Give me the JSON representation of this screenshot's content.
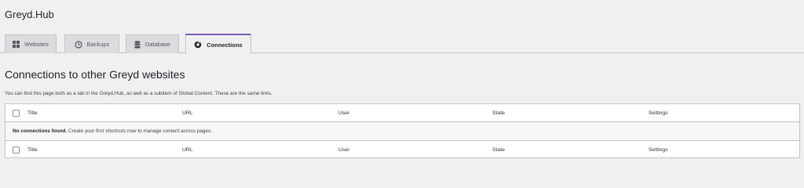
{
  "app": {
    "title": "Greyd.Hub"
  },
  "tabs": [
    {
      "label": "Websites",
      "icon": "grid-icon",
      "active": false
    },
    {
      "label": "Backups",
      "icon": "history-icon",
      "active": false
    },
    {
      "label": "Database",
      "icon": "database-icon",
      "active": false
    },
    {
      "label": "Connections",
      "icon": "connections-icon",
      "active": true
    }
  ],
  "main": {
    "heading": "Connections to other Greyd websites",
    "description": "You can find this page both as a tab in the Greyd.Hub, as well as a subitem of Global Content. These are the same links."
  },
  "table": {
    "columns": [
      "Title",
      "URL",
      "User",
      "State",
      "Settings"
    ],
    "empty_bold": "No connections found.",
    "empty_text": " Create your first shortcuts now to manage content across pages."
  },
  "colors": {
    "accent": "#7a5ab5",
    "background": "#f0f0f1"
  }
}
